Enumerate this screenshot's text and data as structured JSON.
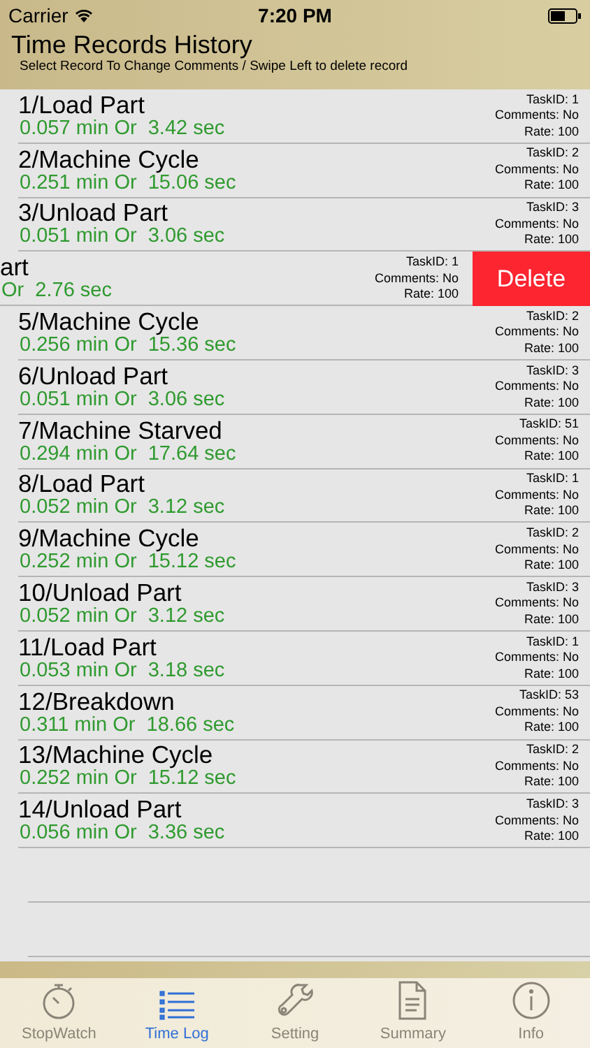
{
  "status_bar": {
    "carrier": "Carrier",
    "time": "7:20 PM"
  },
  "header": {
    "title": "Time Records History",
    "subtitle": "Select Record To Change Comments / Swipe Left to delete record"
  },
  "rows": [
    {
      "title": "1/Load Part",
      "time": "0.057 min Or  3.42 sec",
      "task_id": "TaskID: 1",
      "comments": "Comments: No",
      "rate": "Rate: 100",
      "swiped": false
    },
    {
      "title": "2/Machine Cycle",
      "time": "0.251 min Or  15.06 sec",
      "task_id": "TaskID: 2",
      "comments": "Comments: No",
      "rate": "Rate: 100",
      "swiped": false
    },
    {
      "title": "3/Unload Part",
      "time": "0.051 min Or  3.06 sec",
      "task_id": "TaskID: 3",
      "comments": "Comments: No",
      "rate": "Rate: 100",
      "swiped": false
    },
    {
      "title": "art",
      "time": "Or  2.76 sec",
      "task_id": "TaskID: 1",
      "comments": "Comments: No",
      "rate": "Rate: 100",
      "swiped": true,
      "delete_label": "Delete"
    },
    {
      "title": "5/Machine Cycle",
      "time": "0.256 min Or  15.36 sec",
      "task_id": "TaskID: 2",
      "comments": "Comments: No",
      "rate": "Rate: 100",
      "swiped": false
    },
    {
      "title": "6/Unload Part",
      "time": "0.051 min Or  3.06 sec",
      "task_id": "TaskID: 3",
      "comments": "Comments: No",
      "rate": "Rate: 100",
      "swiped": false
    },
    {
      "title": "7/Machine Starved",
      "time": "0.294 min Or  17.64 sec",
      "task_id": "TaskID: 51",
      "comments": "Comments: No",
      "rate": "Rate: 100",
      "swiped": false
    },
    {
      "title": "8/Load Part",
      "time": "0.052 min Or  3.12 sec",
      "task_id": "TaskID: 1",
      "comments": "Comments: No",
      "rate": "Rate: 100",
      "swiped": false
    },
    {
      "title": "9/Machine Cycle",
      "time": "0.252 min Or  15.12 sec",
      "task_id": "TaskID: 2",
      "comments": "Comments: No",
      "rate": "Rate: 100",
      "swiped": false
    },
    {
      "title": "10/Unload Part",
      "time": "0.052 min Or  3.12 sec",
      "task_id": "TaskID: 3",
      "comments": "Comments: No",
      "rate": "Rate: 100",
      "swiped": false
    },
    {
      "title": "11/Load Part",
      "time": "0.053 min Or  3.18 sec",
      "task_id": "TaskID: 1",
      "comments": "Comments: No",
      "rate": "Rate: 100",
      "swiped": false
    },
    {
      "title": "12/Breakdown",
      "time": "0.311 min Or  18.66 sec",
      "task_id": "TaskID: 53",
      "comments": "Comments: No",
      "rate": "Rate: 100",
      "swiped": false
    },
    {
      "title": "13/Machine Cycle",
      "time": "0.252 min Or  15.12 sec",
      "task_id": "TaskID: 2",
      "comments": "Comments: No",
      "rate": "Rate: 100",
      "swiped": false
    },
    {
      "title": "14/Unload Part",
      "time": "0.056 min Or  3.36 sec",
      "task_id": "TaskID: 3",
      "comments": "Comments: No",
      "rate": "Rate: 100",
      "swiped": false
    }
  ],
  "tabs": [
    {
      "label": "StopWatch",
      "kind": "stopwatch",
      "selected": false
    },
    {
      "label": "Time Log",
      "kind": "list",
      "selected": true
    },
    {
      "label": "Setting",
      "kind": "wrench",
      "selected": false
    },
    {
      "label": "Summary",
      "kind": "document",
      "selected": false
    },
    {
      "label": "Info",
      "kind": "info",
      "selected": false
    }
  ]
}
